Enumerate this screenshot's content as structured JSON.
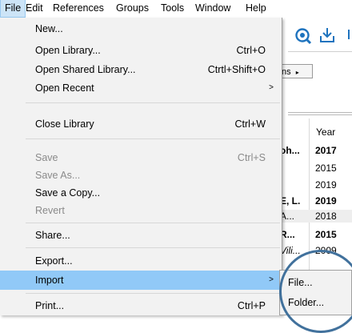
{
  "menubar": {
    "items": [
      "File",
      "Edit",
      "References",
      "Groups",
      "Tools",
      "Window",
      "Help"
    ]
  },
  "toolbar": {
    "icons": [
      "globe-search-icon",
      "import-download-icon"
    ],
    "partial_text": "ns",
    "partial_arrow": "▸"
  },
  "table": {
    "year_header": "Year",
    "rows": [
      {
        "author": "oh...",
        "year": "2017",
        "bold": true,
        "alt": false,
        "italic": false
      },
      {
        "author": "",
        "year": "2015",
        "bold": false,
        "alt": false,
        "italic": false
      },
      {
        "author": "",
        "year": "2019",
        "bold": false,
        "alt": false,
        "italic": false
      },
      {
        "author": "E, L.",
        "year": "2019",
        "bold": true,
        "alt": false,
        "italic": false
      },
      {
        "author": "A...",
        "year": "2018",
        "bold": false,
        "alt": true,
        "italic": false
      },
      {
        "author": "R...",
        "year": "2015",
        "bold": true,
        "alt": false,
        "italic": false
      },
      {
        "author": "Vili...",
        "year": "2009",
        "bold": false,
        "alt": false,
        "italic": true
      }
    ]
  },
  "file_menu": {
    "new": "New...",
    "open_library": "Open Library...",
    "open_library_sc": "Ctrl+O",
    "open_shared": "Open Shared Library...",
    "open_shared_sc": "Ctrtl+Shift+O",
    "open_recent": "Open Recent",
    "submenu_arrow": ">",
    "close_library": "Close Library",
    "close_library_sc": "Ctrl+W",
    "save": "Save",
    "save_sc": "Ctrl+S",
    "save_as": "Save As...",
    "save_copy": "Save a Copy...",
    "revert": "Revert",
    "share": "Share...",
    "export": "Export...",
    "import": "Import",
    "print": "Print...",
    "print_sc": "Ctrl+P"
  },
  "import_submenu": {
    "file": "File...",
    "folder": "Folder..."
  },
  "colors": {
    "highlight": "#91c9f7",
    "annotation_circle": "#41719c",
    "icon_blue": "#1e73be"
  }
}
